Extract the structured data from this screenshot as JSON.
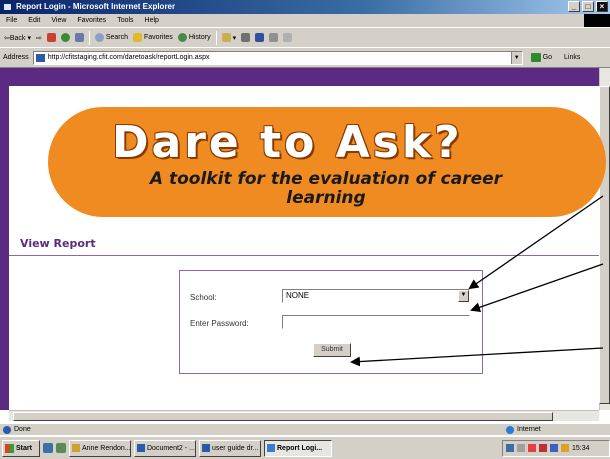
{
  "window": {
    "title": "Report Login - Microsoft Internet Explorer"
  },
  "menu": [
    "File",
    "Edit",
    "View",
    "Favorites",
    "Tools",
    "Help"
  ],
  "toolbar": {
    "back_label": "⇦Back",
    "search_label": "Search",
    "favorites_label": "Favorites",
    "history_label": "History"
  },
  "address": {
    "label": "Address",
    "url": "http://cfitstaging.cfit.com/daretoask/reportLogin.aspx",
    "go_label": "Go",
    "links_label": "Links"
  },
  "banner": {
    "title": "Dare to Ask?",
    "subtitle": "A toolkit for the evaluation of career learning"
  },
  "page": {
    "heading": "View Report"
  },
  "form": {
    "school_label": "School:",
    "school_value": "NONE",
    "password_label": "Enter Password:",
    "password_value": "",
    "submit_label": "Submit"
  },
  "status": {
    "text": "Done",
    "zone": "Internet"
  },
  "taskbar": {
    "start_label": "Start",
    "tasks": [
      {
        "label": "Anne Rendon..."
      },
      {
        "label": "Document2 - ..."
      },
      {
        "label": "user guide dr..."
      },
      {
        "label": "Report Logi..."
      }
    ],
    "clock": "15:34"
  },
  "icons": {
    "back": "back-arrow-icon",
    "forward": "forward-arrow-icon",
    "stop": "stop-icon",
    "refresh": "refresh-icon",
    "home": "home-icon",
    "search": "search-icon",
    "favorites": "favorites-icon",
    "history": "history-icon",
    "mail": "mail-icon",
    "print": "print-icon",
    "edit": "edit-icon",
    "discuss": "discuss-icon",
    "go": "go-arrow-icon",
    "globe": "internet-globe-icon"
  },
  "colors": {
    "banner_orange": "#f08b22",
    "site_purple": "#5b2a82",
    "titlebar_blue": "#0a246a"
  }
}
